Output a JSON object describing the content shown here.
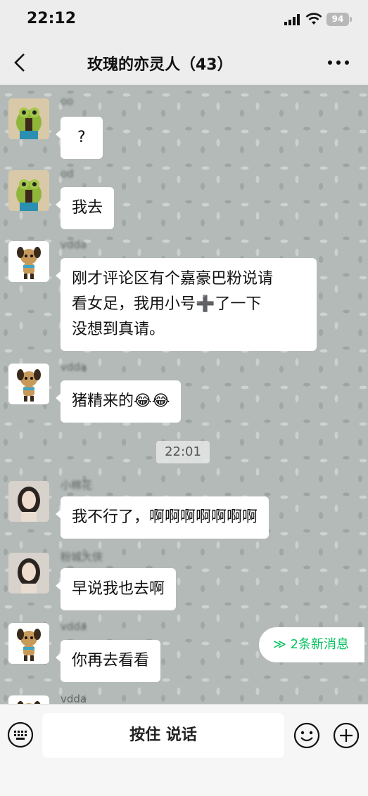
{
  "status_bar": {
    "time": "22:12",
    "battery": "94"
  },
  "nav": {
    "title": "玫瑰的亦灵人（43）"
  },
  "messages": [
    {
      "sender": "oo",
      "text": "?"
    },
    {
      "sender": "od",
      "text": "我去"
    },
    {
      "sender": "vdda",
      "text": [
        "刚才评论区有个嘉豪巴粉说请",
        "看女足，我用小号➕了一下",
        "没想到真请。"
      ]
    },
    {
      "sender": "vdda",
      "text": "猪精来的😂😂"
    },
    {
      "sender": "小棉花",
      "text": "我不行了，啊啊啊啊啊啊啊"
    },
    {
      "sender": "粉城大侠",
      "text": "早说我也去啊"
    },
    {
      "sender": "vdda",
      "text": "你再去看看"
    },
    {
      "sender": "vdda",
      "text": ""
    }
  ],
  "time_divider": "22:01",
  "new_messages": "≫ 2条新消息",
  "input_bar": {
    "talk_label": "按住 说话"
  },
  "colors": {
    "accent": "#07c160",
    "bubble": "#ffffff",
    "chat_bg": "#b4bab7"
  },
  "icons": [
    "back-arrow-icon",
    "more-icon",
    "keyboard-icon",
    "emoji-icon",
    "plus-icon",
    "signal-icon",
    "wifi-icon",
    "battery-icon"
  ]
}
